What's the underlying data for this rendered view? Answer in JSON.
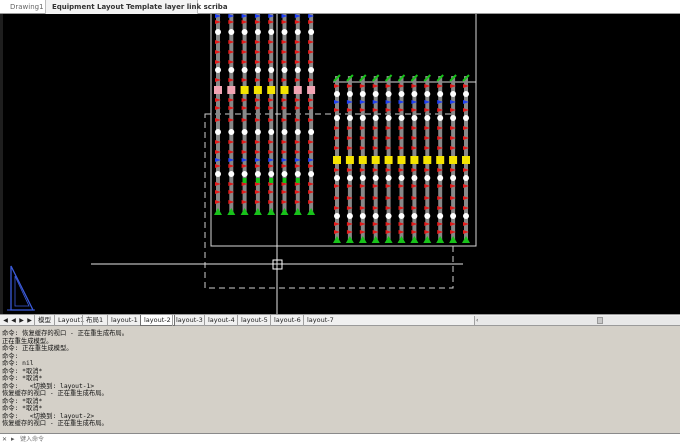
{
  "doc_tabs": [
    "Drawing1",
    "Equipment Layout Template layer link scriba"
  ],
  "layout_tabs": [
    "模型",
    "Layout1",
    "布局1",
    "layout-1",
    "layout-2",
    "layout-3",
    "layout-4",
    "layout-5",
    "layout-6",
    "layout-7"
  ],
  "active_layout_tab": "layout-2",
  "nav_buttons": [
    "◀",
    "◀",
    "▶",
    "▶"
  ],
  "command_history": [
    "命令: 恢复缓存的视口 - 正在重生成布局。",
    "正在重生成模型。",
    "命令: 正在重生成模型。",
    "命令:",
    "命令: nil",
    "命令: *取消*",
    "命令: *取消*",
    "命令:   <切换到: layout-1>",
    "恢复缓存的视口 - 正在重生成布局。",
    "命令: *取消*",
    "命令: *取消*",
    "命令:   <切换到: layout-2>",
    "恢复缓存的视口 - 正在重生成布局。"
  ],
  "command_input": {
    "placeholder": "键入命令",
    "value": ""
  },
  "colors": {
    "canvas_bg": "#000000",
    "rail": "#888888",
    "red_marker": "#e41a1a",
    "blue_marker": "#1f3ff5",
    "green_marker": "#18c21a",
    "yellow_block": "#f5e400",
    "pink_block": "#f2a5b4",
    "white_node": "#ffffff",
    "frame": "#d9d9d9"
  },
  "icons": {
    "close": "close-icon",
    "prompt": "command-prompt-icon",
    "ucs": "ucs-icon",
    "crosshair": "crosshair-cursor-icon"
  }
}
